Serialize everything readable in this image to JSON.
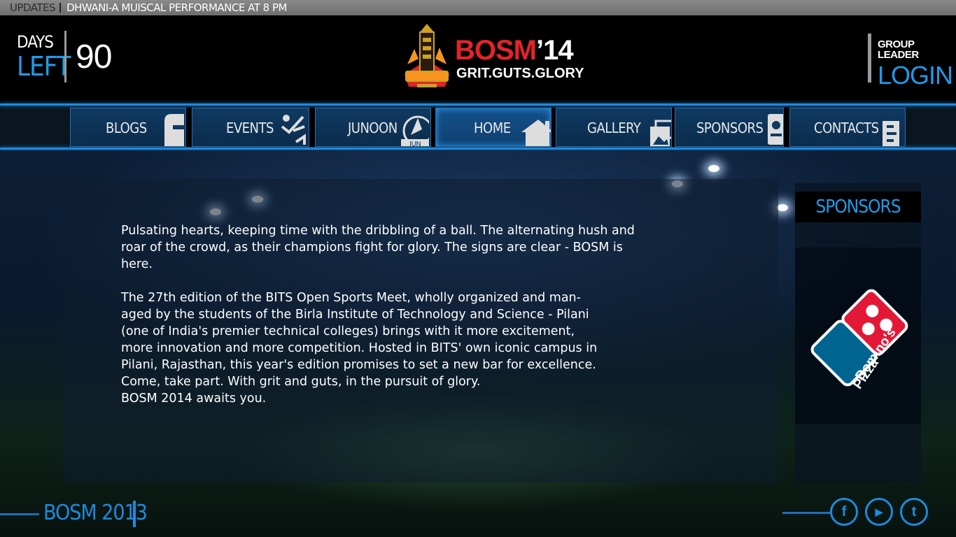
{
  "ticker": {
    "label": "UPDATES",
    "message": "DHWANI-A MUISCAL PERFORMANCE AT 8 PM"
  },
  "countdown": {
    "days": "DAYS",
    "left": "LEFT",
    "value": "90"
  },
  "brand": {
    "name": "BOSM",
    "year": "’14",
    "tagline": "GRIT.GUTS.GLORY"
  },
  "login": {
    "label": "GROUP LEADER",
    "action": "LOGIN"
  },
  "nav": {
    "items": [
      {
        "label": "BLOGS",
        "icon": "blog-icon"
      },
      {
        "label": "EVENTS",
        "icon": "events-icon"
      },
      {
        "label": "JUNOON",
        "icon": "junoon-icon",
        "icon_text": "JUN"
      },
      {
        "label": "HOME",
        "icon": "home-icon",
        "active": true
      },
      {
        "label": "GALLERY",
        "icon": "gallery-icon"
      },
      {
        "label": "SPONSORS",
        "icon": "sponsors-icon"
      },
      {
        "label": "CONTACTS",
        "icon": "contacts-icon"
      }
    ]
  },
  "main": {
    "paragraph1": "Pulsating hearts, keeping time with the dribbling of a ball. The alternating hush and roar of the crowd, as their champions fight for glory. The signs are clear - BOSM is here.",
    "paragraph2_lines": [
      "The 27th edition of the BITS Open Sports Meet, wholly organized and man-",
      "aged by the students of the Birla Institute of Technology and Science - Pilani",
      "(one of India's premier technical colleges) brings with it more excitement,",
      "more innovation and more competition. Hosted in BITS' own iconic campus in",
      "Pilani, Rajasthan, this year's edition promises to set a new bar for excellence.",
      "Come, take part. With grit and guts, in the pursuit of glory.",
      "BOSM 2014 awaits you."
    ]
  },
  "sponsors": {
    "title": "SPONSORS",
    "logo": {
      "name": "Domino's Pizza",
      "line1": "Domino's",
      "line2": "Pizza",
      "colors": {
        "red": "#e31837",
        "blue": "#006491"
      }
    }
  },
  "footer": {
    "title": "BOSM 2013",
    "social": [
      {
        "name": "facebook-icon",
        "glyph": "f"
      },
      {
        "name": "youtube-icon",
        "glyph": "▶"
      },
      {
        "name": "twitter-icon",
        "glyph": "t"
      }
    ]
  },
  "colors": {
    "accent": "#1e9be8",
    "brand_red": "#e2232a"
  }
}
